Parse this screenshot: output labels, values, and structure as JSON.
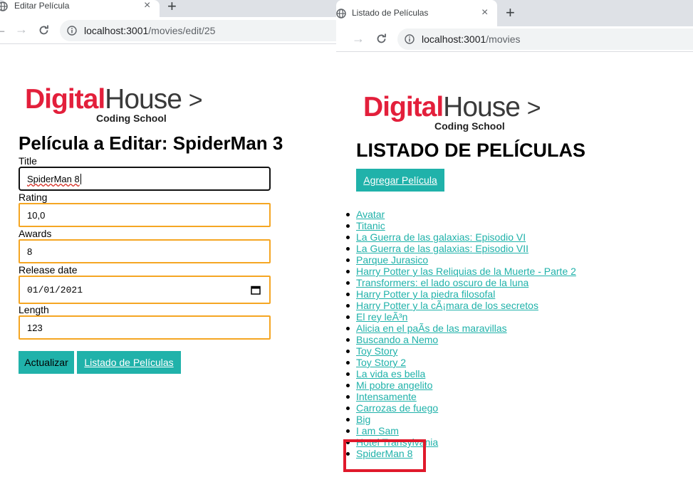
{
  "left_window": {
    "tab_title": "Editar Película",
    "url_host": "localhost:3001",
    "url_path": "/movies/edit/25",
    "logo": {
      "digital": "Digital",
      "house": "House",
      "chevron": ">",
      "tagline": "Coding School"
    },
    "page_title": "Película a Editar: SpiderMan 3",
    "form": {
      "title_label": "Title",
      "title_value": "SpiderMan 8",
      "rating_label": "Rating",
      "rating_value": "10,0",
      "awards_label": "Awards",
      "awards_value": "8",
      "release_label": "Release date",
      "release_value": "01/01/2021",
      "length_label": "Length",
      "length_value": "123"
    },
    "buttons": {
      "update": "Actualizar",
      "list": "Listado de Películas"
    }
  },
  "right_window": {
    "tab_title": "Listado de Películas",
    "url_host": "localhost:3001",
    "url_path": "/movies",
    "logo": {
      "digital": "Digital",
      "house": "House",
      "chevron": ">",
      "tagline": "Coding School"
    },
    "page_title": "LISTADO DE PELÍCULAS",
    "add_button": "Agregar Película",
    "movies": [
      "Avatar",
      "Titanic",
      "La Guerra de las galaxias: Episodio VI",
      "La Guerra de las galaxias: Episodio VII",
      "Parque Jurasico",
      "Harry Potter y las Reliquias de la Muerte - Parte 2",
      "Transformers: el lado oscuro de la luna",
      "Harry Potter y la piedra filosofal",
      "Harry Potter y la cÃ¡mara de los secretos",
      "El rey leÃ³n",
      "Alicia en el paÃ­s de las maravillas",
      "Buscando a Nemo",
      "Toy Story",
      "Toy Story 2",
      "La vida es bella",
      "Mi pobre angelito",
      "Intensamente",
      "Carrozas de fuego",
      "Big",
      "I am Sam",
      "Hotel Transylvania",
      "SpiderMan 8"
    ]
  },
  "colors": {
    "brand_red": "#e31f3b",
    "accent_teal": "#20b2aa",
    "input_border": "#f5a623",
    "highlight_red": "#e0192b"
  },
  "icons": {
    "tab": "globe-icon",
    "site_info": "info-icon",
    "calendar": "calendar-icon"
  }
}
